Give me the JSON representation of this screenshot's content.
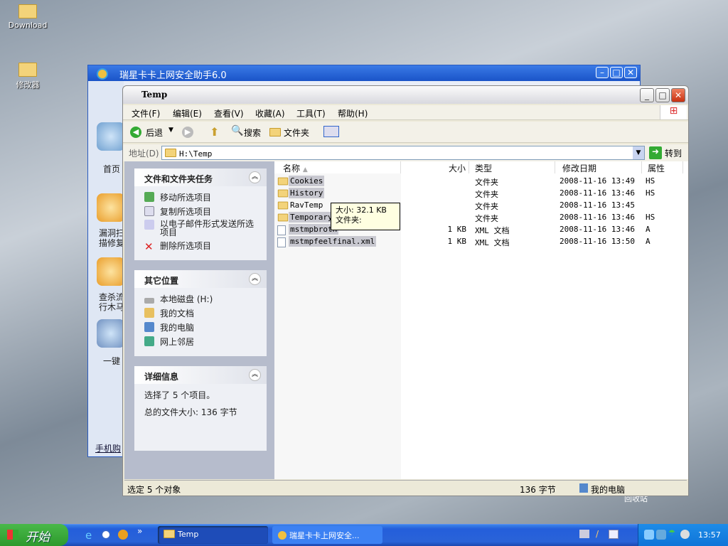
{
  "desktop": {
    "icons": [
      {
        "label": "Download"
      },
      {
        "label": "修改器"
      }
    ],
    "recycle_bin": "回收站"
  },
  "back_window": {
    "title": "瑞星卡卡上网安全助手6.0",
    "sidebar": [
      "首页",
      "漏洞扫描修复",
      "查杀流行木马",
      "一键"
    ],
    "footer_link": "手机购"
  },
  "explorer": {
    "title": "Temp",
    "menu": [
      "文件(F)",
      "编辑(E)",
      "查看(V)",
      "收藏(A)",
      "工具(T)",
      "帮助(H)"
    ],
    "toolbar": {
      "back": "后退",
      "search": "搜索",
      "folders": "文件夹"
    },
    "address": {
      "label": "地址(D)",
      "value": "H:\\Temp",
      "go": "转到"
    },
    "tasks": {
      "title": "文件和文件夹任务",
      "items": [
        "移动所选项目",
        "复制所选项目",
        "以电子邮件形式发送所选项目",
        "删除所选项目"
      ]
    },
    "places": {
      "title": "其它位置",
      "items": [
        "本地磁盘 (H:)",
        "我的文档",
        "我的电脑",
        "网上邻居"
      ]
    },
    "details": {
      "title": "详细信息",
      "line1": "选择了 5 个项目。",
      "line2": "总的文件大小: 136 字节"
    },
    "columns": [
      "名称",
      "大小",
      "类型",
      "修改日期",
      "属性"
    ],
    "files": [
      {
        "name": "Cookies",
        "size": "",
        "type": "文件夹",
        "date": "2008-11-16 13:49",
        "attr": "HS",
        "selected": true,
        "icon": "folder"
      },
      {
        "name": "History",
        "size": "",
        "type": "文件夹",
        "date": "2008-11-16 13:46",
        "attr": "HS",
        "selected": true,
        "icon": "folder"
      },
      {
        "name": "RavTemp",
        "size": "",
        "type": "文件夹",
        "date": "2008-11-16 13:45",
        "attr": "",
        "selected": false,
        "icon": "folder"
      },
      {
        "name": "Temporary",
        "size": "",
        "type": "文件夹",
        "date": "2008-11-16 13:46",
        "attr": "HS",
        "selected": true,
        "icon": "folder"
      },
      {
        "name": "mstmpbroth",
        "size": "1 KB",
        "type": "XML 文档",
        "date": "2008-11-16 13:46",
        "attr": "A",
        "selected": true,
        "icon": "xml"
      },
      {
        "name": "mstmpfeelfinal.xml",
        "size": "1 KB",
        "type": "XML 文档",
        "date": "2008-11-16 13:50",
        "attr": "A",
        "selected": true,
        "icon": "xml"
      }
    ],
    "tooltip": {
      "line1": "大小: 32.1 KB",
      "line2": "文件夹:"
    },
    "status": {
      "left": "选定 5 个对象",
      "size": "136 字节",
      "location": "我的电脑"
    }
  },
  "taskbar": {
    "start": "开始",
    "tasks": [
      "Temp",
      "瑞星卡卡上网安全..."
    ],
    "clock": "13:57"
  }
}
